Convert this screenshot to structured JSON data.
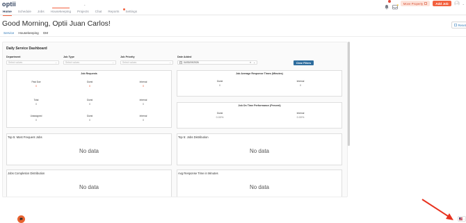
{
  "app": {
    "logo": "optii"
  },
  "nav": {
    "items": [
      {
        "label": "Home",
        "active": true
      },
      {
        "label": "Schedule"
      },
      {
        "label": "Jobs"
      },
      {
        "label": "Housekeeping"
      },
      {
        "label": "Projects"
      },
      {
        "label": "Chat"
      },
      {
        "label": "Reports"
      },
      {
        "label": "Settings"
      }
    ]
  },
  "header_tools": {
    "move_property_label": "Move Property",
    "add_job_label": "Add Job"
  },
  "greeting": "Good Morning, Optii Juan Carlos!",
  "reset_label": "Reset",
  "subtabs": [
    "Service",
    "Housekeeping",
    "GM"
  ],
  "dashboard": {
    "title": "Daily Service Dashboard",
    "filters": {
      "department": {
        "label": "Department",
        "placeholder": "Select values"
      },
      "job_type": {
        "label": "Job Type",
        "placeholder": "Select values"
      },
      "job_priority": {
        "label": "Job Priority",
        "placeholder": "Select values"
      },
      "date_added": {
        "label": "Date Added",
        "value": "04/30/19/2026"
      }
    },
    "clear_filters_label": "Clear Filters",
    "job_requests": {
      "title": "Job Requests",
      "rows": [
        [
          {
            "label": "Past Due",
            "value": "0"
          },
          {
            "label": "Guest",
            "value": "0"
          },
          {
            "label": "Internal",
            "value": "0"
          }
        ],
        [
          {
            "label": "Total",
            "value": "0"
          },
          {
            "label": "Guest",
            "value": "0"
          },
          {
            "label": "Internal",
            "value": "0"
          }
        ],
        [
          {
            "label": "Unassigned",
            "value": "0"
          },
          {
            "label": "Guest",
            "value": "0"
          },
          {
            "label": "Internal",
            "value": "0"
          }
        ]
      ]
    },
    "response_times": {
      "title": "Job Average Response Times (Minutes)",
      "guest_label": "Guest",
      "guest_value": "0",
      "internal_label": "Internal",
      "internal_value": "0"
    },
    "on_time": {
      "title": "Job On Time Performance (Percent)",
      "guest_label": "Guest",
      "guest_value": "0.00%",
      "internal_label": "Internal",
      "internal_value": "0.00%"
    },
    "widgets": [
      {
        "title": "Top 5: Most Frequent Jobs",
        "empty": "No data"
      },
      {
        "title": "Top 5: Jobs Distribution",
        "empty": "No data"
      },
      {
        "title": "Jobs Completion Distribution",
        "empty": "No data"
      },
      {
        "title": "Avg Response Time in Minutes",
        "empty": "No data"
      }
    ]
  },
  "colors": {
    "brand_orange": "#f2613f",
    "brand_navy": "#2e3f5c",
    "link_blue": "#2e78b7",
    "annotation_red": "#e8321f"
  }
}
